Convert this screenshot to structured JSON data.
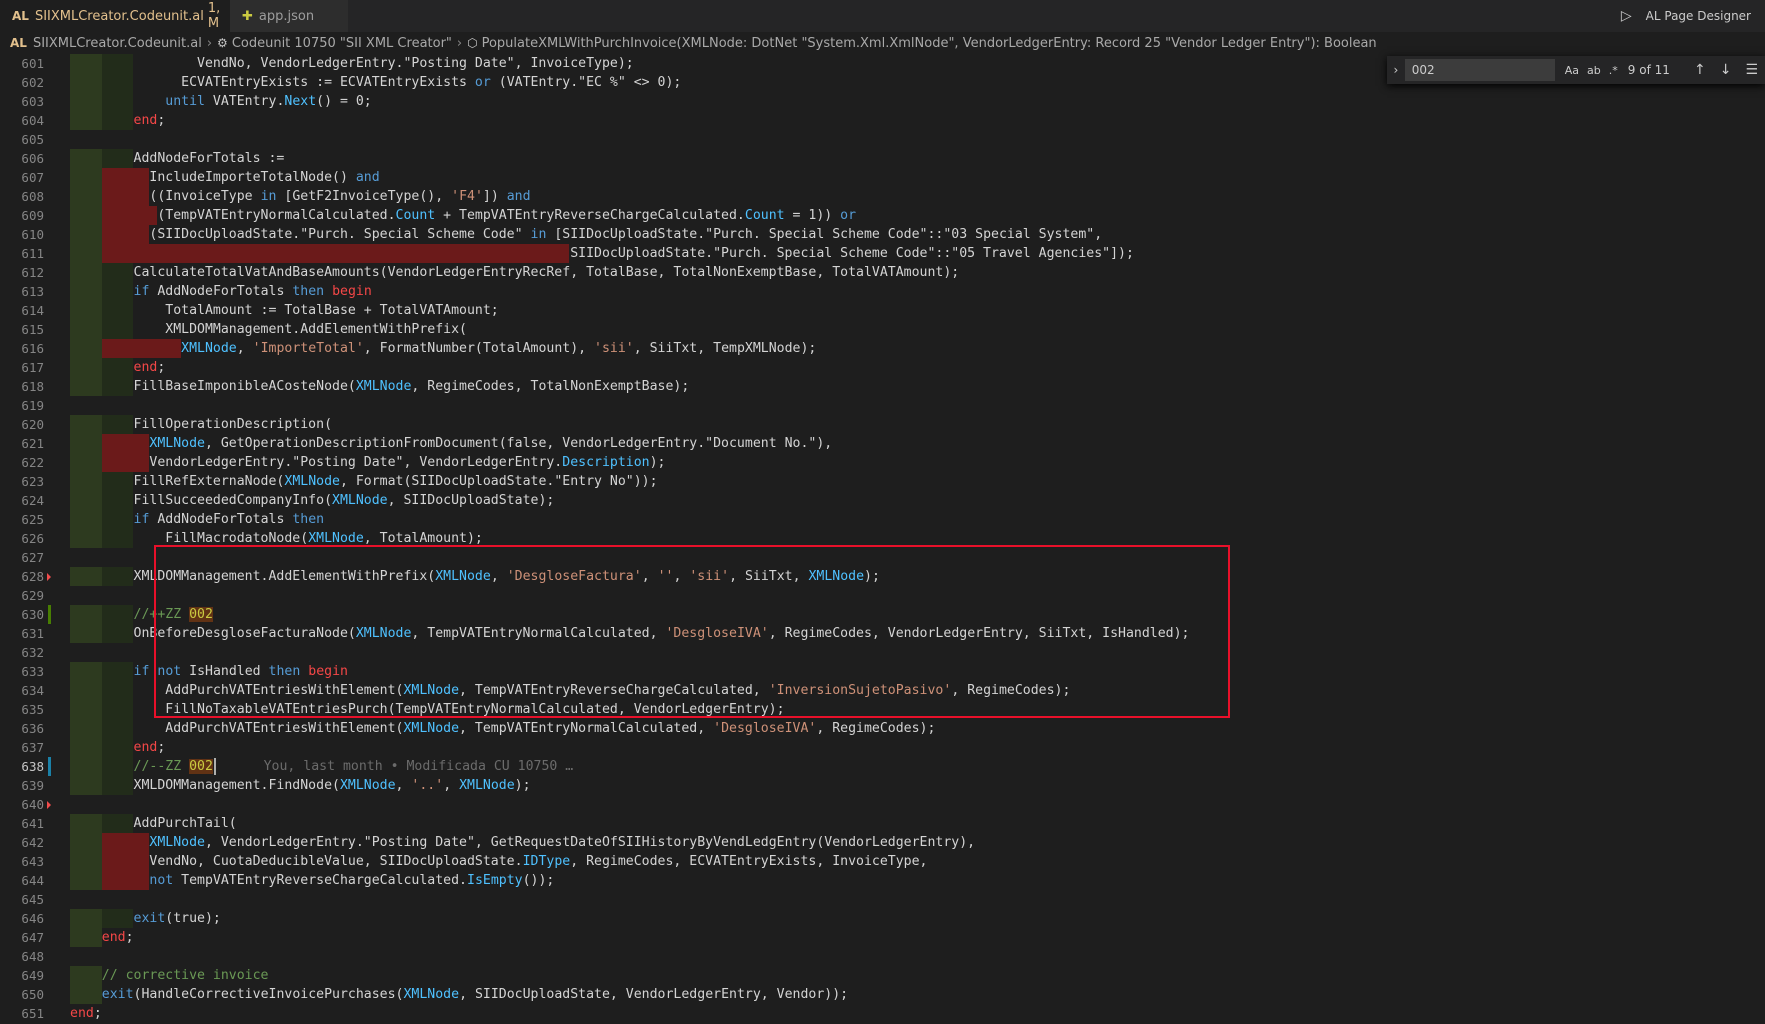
{
  "tabs": [
    {
      "lang": "AL",
      "label": "SIIXMLCreator.Codeunit.al",
      "status": "1, M"
    },
    {
      "label": "app.json"
    }
  ],
  "run_button": {
    "label": "AL Page Designer"
  },
  "breadcrumb": {
    "lang": "AL",
    "file": "SIIXMLCreator.Codeunit.al",
    "object": "Codeunit 10750 \"SII XML Creator\"",
    "method": "PopulateXMLWithPurchInvoice(XMLNode: DotNet \"System.Xml.XmlNode\", VendorLedgerEntry: Record 25 \"Vendor Ledger Entry\"): Boolean"
  },
  "find": {
    "value": "002",
    "case_label": "Aa",
    "word_label": "ab",
    "regex_label": ".*",
    "count": "9 of 11"
  },
  "blame": "You, last month • Modificada CU 10750 …",
  "lines": [
    {
      "n": "601",
      "t": "                VendNo, VendorLedgerEntry.\"Posting Date\", InvoiceType);"
    },
    {
      "n": "602",
      "t": "              ECVATEntryExists := ECVATEntryExists or (VATEntry.\"EC %\" <> 0);"
    },
    {
      "n": "603",
      "t": "            until VATEntry.Next() = 0;"
    },
    {
      "n": "604",
      "t": "        end;"
    },
    {
      "n": "605",
      "t": ""
    },
    {
      "n": "606",
      "t": "        AddNodeForTotals :="
    },
    {
      "n": "607",
      "t": "          IncludeImporteTotalNode() and"
    },
    {
      "n": "608",
      "t": "          ((InvoiceType in [GetF2InvoiceType(), 'F4']) and"
    },
    {
      "n": "609",
      "t": "           (TempVATEntryNormalCalculated.Count + TempVATEntryReverseChargeCalculated.Count = 1)) or"
    },
    {
      "n": "610",
      "t": "          (SIIDocUploadState.\"Purch. Special Scheme Code\" in [SIIDocUploadState.\"Purch. Special Scheme Code\"::\"03 Special System\","
    },
    {
      "n": "611",
      "t": "                                                               SIIDocUploadState.\"Purch. Special Scheme Code\"::\"05 Travel Agencies\"]);"
    },
    {
      "n": "612",
      "t": "        CalculateTotalVatAndBaseAmounts(VendorLedgerEntryRecRef, TotalBase, TotalNonExemptBase, TotalVATAmount);"
    },
    {
      "n": "613",
      "t": "        if AddNodeForTotals then begin"
    },
    {
      "n": "614",
      "t": "            TotalAmount := TotalBase + TotalVATAmount;"
    },
    {
      "n": "615",
      "t": "            XMLDOMManagement.AddElementWithPrefix("
    },
    {
      "n": "616",
      "t": "              XMLNode, 'ImporteTotal', FormatNumber(TotalAmount), 'sii', SiiTxt, TempXMLNode);"
    },
    {
      "n": "617",
      "t": "        end;"
    },
    {
      "n": "618",
      "t": "        FillBaseImponibleACosteNode(XMLNode, RegimeCodes, TotalNonExemptBase);"
    },
    {
      "n": "619",
      "t": ""
    },
    {
      "n": "620",
      "t": "        FillOperationDescription("
    },
    {
      "n": "621",
      "t": "          XMLNode, GetOperationDescriptionFromDocument(false, VendorLedgerEntry.\"Document No.\"),"
    },
    {
      "n": "622",
      "t": "          VendorLedgerEntry.\"Posting Date\", VendorLedgerEntry.Description);"
    },
    {
      "n": "623",
      "t": "        FillRefExternaNode(XMLNode, Format(SIIDocUploadState.\"Entry No\"));"
    },
    {
      "n": "624",
      "t": "        FillSucceededCompanyInfo(XMLNode, SIIDocUploadState);"
    },
    {
      "n": "625",
      "t": "        if AddNodeForTotals then"
    },
    {
      "n": "626",
      "t": "            FillMacrodatoNode(XMLNode, TotalAmount);"
    },
    {
      "n": "627",
      "t": ""
    },
    {
      "n": "628",
      "t": "        XMLDOMManagement.AddElementWithPrefix(XMLNode, 'DesgloseFactura', '', 'sii', SiiTxt, XMLNode);"
    },
    {
      "n": "629",
      "t": ""
    },
    {
      "n": "630",
      "t": "        //++ZZ 002"
    },
    {
      "n": "631",
      "t": "        OnBeforeDesgloseFacturaNode(XMLNode, TempVATEntryNormalCalculated, 'DesgloseIVA', RegimeCodes, VendorLedgerEntry, SiiTxt, IsHandled);"
    },
    {
      "n": "632",
      "t": ""
    },
    {
      "n": "633",
      "t": "        if not IsHandled then begin"
    },
    {
      "n": "634",
      "t": "            AddPurchVATEntriesWithElement(XMLNode, TempVATEntryReverseChargeCalculated, 'InversionSujetoPasivo', RegimeCodes);"
    },
    {
      "n": "635",
      "t": "            FillNoTaxableVATEntriesPurch(TempVATEntryNormalCalculated, VendorLedgerEntry);"
    },
    {
      "n": "636",
      "t": "            AddPurchVATEntriesWithElement(XMLNode, TempVATEntryNormalCalculated, 'DesgloseIVA', RegimeCodes);"
    },
    {
      "n": "637",
      "t": "        end;"
    },
    {
      "n": "638",
      "t": "        //--ZZ 002"
    },
    {
      "n": "639",
      "t": "        XMLDOMManagement.FindNode(XMLNode, '..', XMLNode);"
    },
    {
      "n": "640",
      "t": ""
    },
    {
      "n": "641",
      "t": "        AddPurchTail("
    },
    {
      "n": "642",
      "t": "          XMLNode, VendorLedgerEntry.\"Posting Date\", GetRequestDateOfSIIHistoryByVendLedgEntry(VendorLedgerEntry),"
    },
    {
      "n": "643",
      "t": "          VendNo, CuotaDeducibleValue, SIIDocUploadState.IDType, RegimeCodes, ECVATEntryExists, InvoiceType,"
    },
    {
      "n": "644",
      "t": "          not TempVATEntryReverseChargeCalculated.IsEmpty());"
    },
    {
      "n": "645",
      "t": ""
    },
    {
      "n": "646",
      "t": "        exit(true);"
    },
    {
      "n": "647",
      "t": "    end;"
    },
    {
      "n": "648",
      "t": ""
    },
    {
      "n": "649",
      "t": "    // corrective invoice"
    },
    {
      "n": "650",
      "t": "    exit(HandleCorrectiveInvoicePurchases(XMLNode, SIIDocUploadState, VendorLedgerEntry, Vendor));"
    },
    {
      "n": "651",
      "t": "end;"
    }
  ]
}
